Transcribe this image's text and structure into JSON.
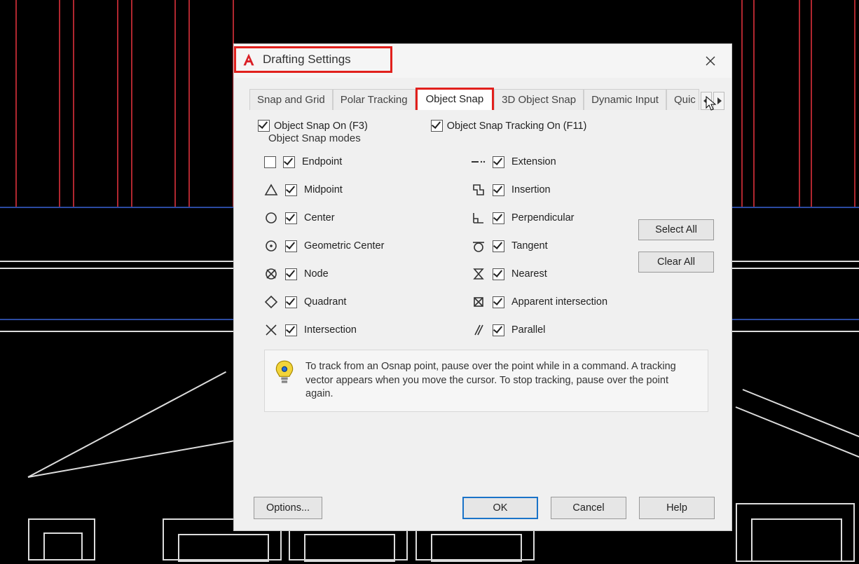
{
  "dialog": {
    "title": "Drafting Settings",
    "tabs": [
      "Snap and Grid",
      "Polar Tracking",
      "Object Snap",
      "3D Object Snap",
      "Dynamic Input",
      "Quic"
    ],
    "active_tab": "Object Snap",
    "osnap_on_label": "Object Snap On (F3)",
    "osnap_track_on_label": "Object Snap Tracking On (F11)",
    "modes_legend": "Object Snap modes",
    "modes_left": [
      {
        "label": "Endpoint"
      },
      {
        "label": "Midpoint"
      },
      {
        "label": "Center"
      },
      {
        "label": "Geometric Center"
      },
      {
        "label": "Node"
      },
      {
        "label": "Quadrant"
      },
      {
        "label": "Intersection"
      }
    ],
    "modes_right": [
      {
        "label": "Extension"
      },
      {
        "label": "Insertion"
      },
      {
        "label": "Perpendicular"
      },
      {
        "label": "Tangent"
      },
      {
        "label": "Nearest"
      },
      {
        "label": "Apparent intersection"
      },
      {
        "label": "Parallel"
      }
    ],
    "select_all_label": "Select All",
    "clear_all_label": "Clear All",
    "hint_text": "To track from an Osnap point, pause over the point while in a command.  A tracking vector appears when you move the cursor.  To stop tracking, pause over the point again.",
    "options_label": "Options...",
    "ok_label": "OK",
    "cancel_label": "Cancel",
    "help_label": "Help"
  }
}
